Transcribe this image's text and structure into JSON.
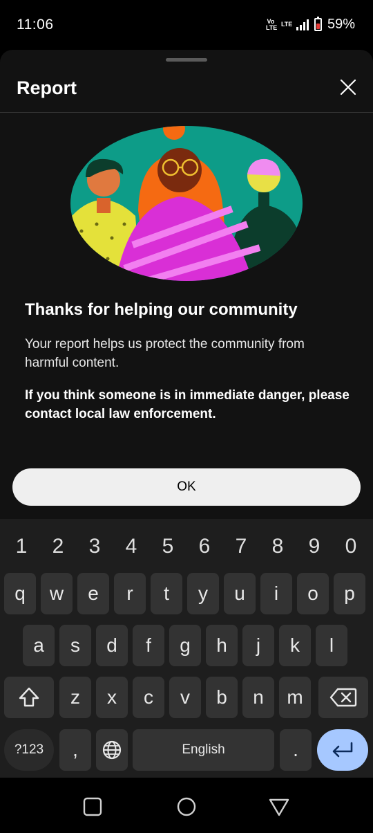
{
  "status_bar": {
    "time": "11:06",
    "volte_label": "Vo LTE",
    "network_label": "LTE",
    "battery_percent": "59%",
    "battery_level": 0.59
  },
  "sheet": {
    "title": "Report",
    "heading": "Thanks for helping our community",
    "description": "Your report helps us protect the community from harmful content.",
    "danger_notice": "If you think someone is in immediate danger, please contact local law enforcement.",
    "ok_label": "OK",
    "close_icon": "close-icon",
    "illustration": "three-people-illustration"
  },
  "keyboard": {
    "number_row": [
      "1",
      "2",
      "3",
      "4",
      "5",
      "6",
      "7",
      "8",
      "9",
      "0"
    ],
    "row1": [
      "q",
      "w",
      "e",
      "r",
      "t",
      "y",
      "u",
      "i",
      "o",
      "p"
    ],
    "row2": [
      "a",
      "s",
      "d",
      "f",
      "g",
      "h",
      "j",
      "k",
      "l"
    ],
    "row3": [
      "z",
      "x",
      "c",
      "v",
      "b",
      "n",
      "m"
    ],
    "symbols_label": "?123",
    "comma_label": ",",
    "space_label": "English",
    "period_label": ".",
    "shift_icon": "shift-icon",
    "backspace_icon": "backspace-icon",
    "globe_icon": "globe-icon",
    "enter_icon": "enter-icon"
  },
  "navbar": {
    "recents_icon": "recents-icon",
    "home_icon": "home-icon",
    "back_icon": "back-icon"
  },
  "colors": {
    "sheet_bg": "#121212",
    "ok_button_bg": "#efefef",
    "enter_key_bg": "#a6c8ff",
    "illustration_teal": "#0d9c88",
    "illustration_magenta": "#d92fd6",
    "illustration_orange": "#f56a12"
  }
}
